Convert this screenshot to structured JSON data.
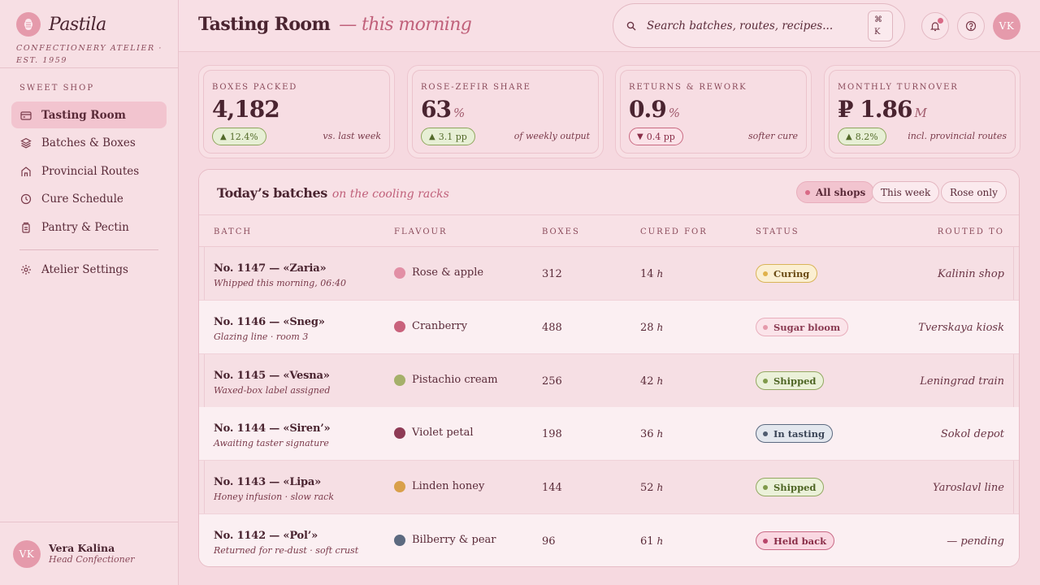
{
  "brand": {
    "name": "Pastila",
    "tagline": "CONFECTIONERY ATELIER · EST. 1959"
  },
  "sidebar": {
    "section_label": "SWEET SHOP",
    "items": [
      {
        "label": "Tasting Room",
        "icon": "card-icon",
        "active": true
      },
      {
        "label": "Batches & Boxes",
        "icon": "layers-icon",
        "active": false
      },
      {
        "label": "Provincial Routes",
        "icon": "shop-icon",
        "active": false
      },
      {
        "label": "Cure Schedule",
        "icon": "clock-icon",
        "active": false
      },
      {
        "label": "Pantry & Pectin",
        "icon": "jar-icon",
        "active": false
      }
    ],
    "settings_label": "Atelier Settings",
    "user": {
      "initials": "VK",
      "name": "Vera Kalina",
      "role": "Head Confectioner"
    }
  },
  "header": {
    "title": "Tasting Room",
    "subtitle": "— this morning",
    "search_placeholder": "Search batches, routes, recipes...",
    "kbd_cmd": "⌘",
    "kbd_key": "K",
    "avatar_initials": "VK"
  },
  "stats": [
    {
      "label": "BOXES PACKED",
      "value": "4,182",
      "unit": "",
      "delta": "12.4%",
      "direction": "up",
      "note": "vs. last week"
    },
    {
      "label": "ROSE-ZEFIR SHARE",
      "value": "63",
      "unit": "%",
      "delta": "3.1 pp",
      "direction": "up",
      "note": "of weekly output"
    },
    {
      "label": "RETURNS & REWORK",
      "value": "0.9",
      "unit": "%",
      "delta": "0.4 pp",
      "direction": "down",
      "note": "softer cure"
    },
    {
      "label": "MONTHLY TURNOVER",
      "value": "₽ 1.86",
      "unit": "M",
      "delta": "8.2%",
      "direction": "up",
      "note": "incl. provincial routes"
    }
  ],
  "batches": {
    "title": "Today’s batches",
    "subtitle": "on the cooling racks",
    "filters": [
      "All shops",
      "This week",
      "Rose only"
    ],
    "columns": [
      "BATCH",
      "FLAVOUR",
      "BOXES",
      "CURED FOR",
      "STATUS",
      "ROUTED TO"
    ],
    "hours_unit": "h",
    "rows": [
      {
        "batch": "No. 1147 — «Zaria»",
        "note": "Whipped this morning, 06:40",
        "flavour": "Rose & apple",
        "swatch": "#e28fa5",
        "boxes": "312",
        "cured": "14",
        "status": "Curing",
        "status_kind": "curing",
        "routed": "Kalinin shop"
      },
      {
        "batch": "No. 1146 — «Sneg»",
        "note": "Glazing line · room 3",
        "flavour": "Cranberry",
        "swatch": "#c9627c",
        "boxes": "488",
        "cured": "28",
        "status": "Sugar bloom",
        "status_kind": "bloom",
        "routed": "Tverskaya kiosk"
      },
      {
        "batch": "No. 1145 — «Vesna»",
        "note": "Waxed-box label assigned",
        "flavour": "Pistachio cream",
        "swatch": "#a5b06a",
        "boxes": "256",
        "cured": "42",
        "status": "Shipped",
        "status_kind": "shipped",
        "routed": "Leningrad train"
      },
      {
        "batch": "No. 1144 — «Siren’»",
        "note": "Awaiting taster signature",
        "flavour": "Violet petal",
        "swatch": "#8e3a55",
        "boxes": "198",
        "cured": "36",
        "status": "In tasting",
        "status_kind": "tasting",
        "routed": "Sokol depot"
      },
      {
        "batch": "No. 1143 — «Lipa»",
        "note": "Honey infusion · slow rack",
        "flavour": "Linden honey",
        "swatch": "#d9a04a",
        "boxes": "144",
        "cured": "52",
        "status": "Shipped",
        "status_kind": "shipped",
        "routed": "Yaroslavl line"
      },
      {
        "batch": "No. 1142 — «Pol’»",
        "note": "Returned for re-dust · soft crust",
        "flavour": "Bilberry & pear",
        "swatch": "#5c6a80",
        "boxes": "96",
        "cured": "61",
        "status": "Held back",
        "status_kind": "held",
        "routed": "— pending"
      }
    ]
  },
  "colors": {
    "accent": "#d96a86",
    "curing": "#e0b24a",
    "shipped": "#7f9a4a",
    "tasting": "#4f5c70",
    "held": "#b8456a"
  }
}
